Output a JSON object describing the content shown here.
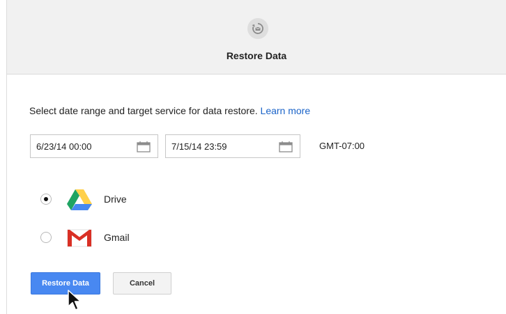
{
  "dialog": {
    "header": {
      "title": "Restore Data",
      "icon": "restore-icon"
    },
    "instruction": {
      "text": "Select date range and target service for data restore.",
      "link": "Learn more"
    },
    "date_range": {
      "start": "6/23/14 00:00",
      "end": "7/15/14 23:59",
      "timezone": "GMT-07:00",
      "icon": "calendar-icon"
    },
    "services": [
      {
        "label": "Drive",
        "selected": true,
        "icon": "google-drive-icon"
      },
      {
        "label": "Gmail",
        "selected": false,
        "icon": "gmail-icon"
      }
    ],
    "actions": {
      "restore_label": "Restore Data",
      "cancel_label": "Cancel"
    }
  },
  "colors": {
    "primary_button": "#4888f1",
    "link": "#1a63c8",
    "header_bg": "#f1f1f1",
    "drive_green": "#1fa463",
    "drive_yellow": "#ffd04b",
    "drive_blue": "#4688f1",
    "gmail_red": "#d93025"
  }
}
